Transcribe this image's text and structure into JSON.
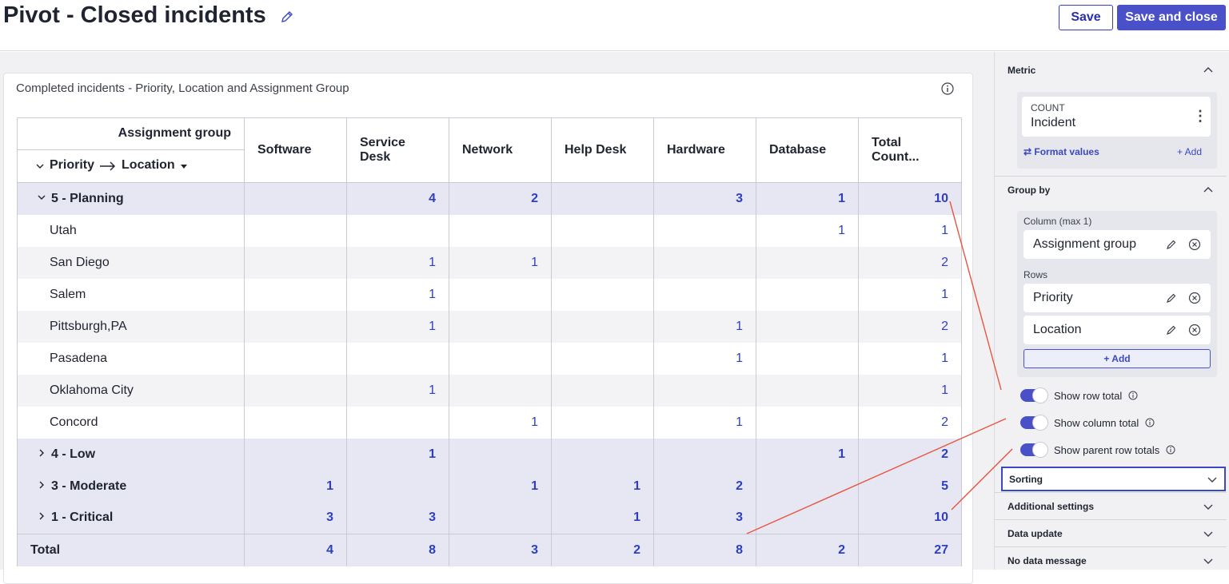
{
  "header": {
    "title": "Pivot - Closed incidents",
    "save_label": "Save",
    "save_close_label": "Save and close"
  },
  "card": {
    "title": "Completed incidents - Priority, Location and Assignment Group"
  },
  "pivot": {
    "corner_top": "Assignment group",
    "corner_priority": "Priority",
    "corner_location": "Location",
    "columns": [
      "Software",
      "Service Desk",
      "Network",
      "Help Desk",
      "Hardware",
      "Database",
      "Total Count..."
    ],
    "rows": [
      {
        "label": "5 - Planning",
        "values": [
          "",
          "4",
          "2",
          "",
          "3",
          "1",
          "10"
        ]
      },
      {
        "label": "Utah",
        "values": [
          "",
          "",
          "",
          "",
          "",
          "1",
          "1"
        ]
      },
      {
        "label": "San Diego",
        "values": [
          "",
          "1",
          "1",
          "",
          "",
          "",
          "2"
        ]
      },
      {
        "label": "Salem",
        "values": [
          "",
          "1",
          "",
          "",
          "",
          "",
          "1"
        ]
      },
      {
        "label": "Pittsburgh,PA",
        "values": [
          "",
          "1",
          "",
          "",
          "1",
          "",
          "2"
        ]
      },
      {
        "label": "Pasadena",
        "values": [
          "",
          "",
          "",
          "",
          "1",
          "",
          "1"
        ]
      },
      {
        "label": "Oklahoma City",
        "values": [
          "",
          "1",
          "",
          "",
          "",
          "",
          "1"
        ]
      },
      {
        "label": "Concord",
        "values": [
          "",
          "",
          "1",
          "",
          "1",
          "",
          "2"
        ]
      },
      {
        "label": "4 - Low",
        "values": [
          "",
          "1",
          "",
          "",
          "",
          "1",
          "2"
        ]
      },
      {
        "label": "3 - Moderate",
        "values": [
          "1",
          "",
          "1",
          "1",
          "2",
          "",
          "5"
        ]
      },
      {
        "label": "1 - Critical",
        "values": [
          "3",
          "3",
          "",
          "1",
          "3",
          "",
          "10"
        ]
      }
    ],
    "total": {
      "label": "Total",
      "values": [
        "4",
        "8",
        "3",
        "2",
        "8",
        "2",
        "27"
      ]
    }
  },
  "panel": {
    "metric": {
      "heading": "Metric",
      "aggregate": "COUNT",
      "table": "Incident",
      "format_values": "Format values",
      "add": "+ Add"
    },
    "group_by": {
      "heading": "Group by",
      "column_label": "Column (max 1)",
      "column_item": "Assignment group",
      "rows_label": "Rows",
      "row_items": [
        "Priority",
        "Location"
      ],
      "add": "+ Add"
    },
    "toggles": [
      "Show row total",
      "Show column total",
      "Show parent row totals"
    ],
    "sections": [
      "Sorting",
      "Additional settings",
      "Data update",
      "No data message"
    ]
  },
  "colors": {
    "accent": "#4a50c8",
    "link": "#2e3fbf",
    "annotation": "#e8553f"
  }
}
